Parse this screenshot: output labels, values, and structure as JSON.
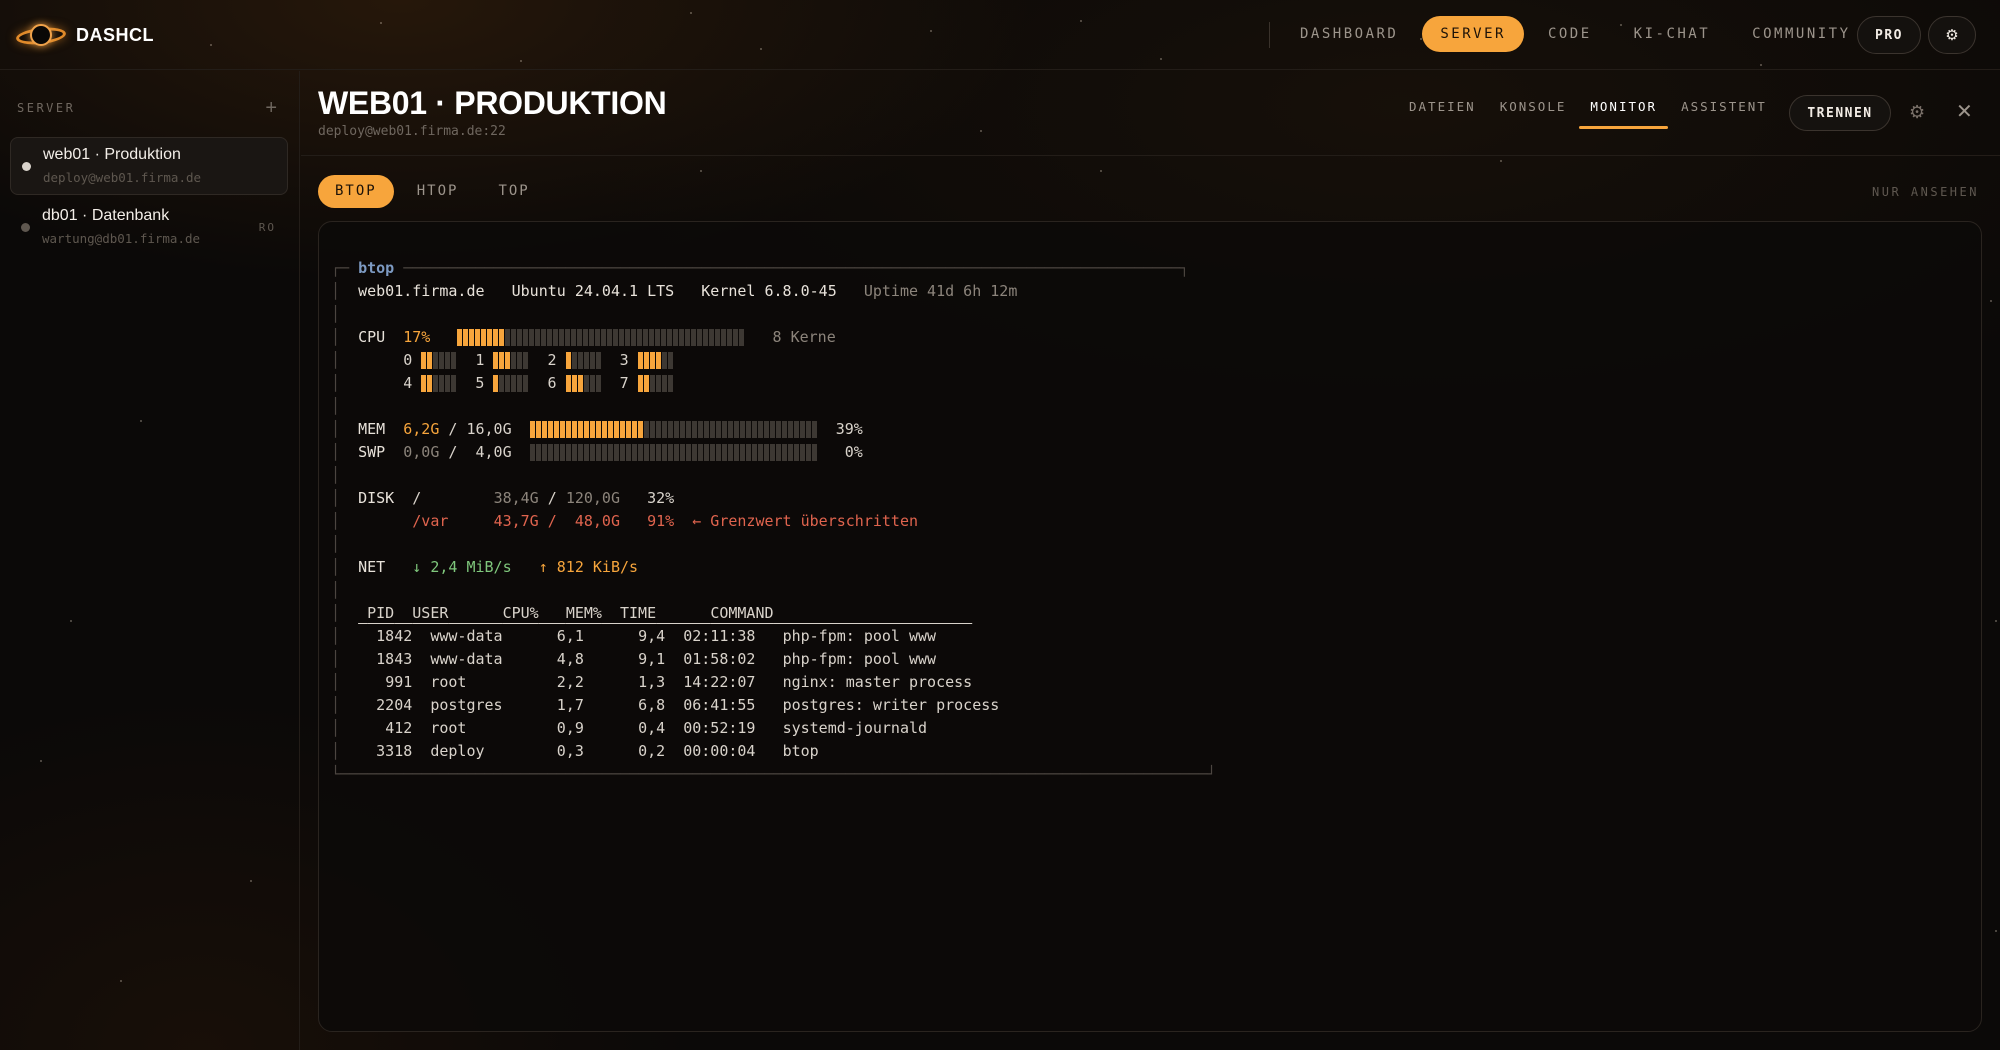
{
  "app": {
    "brand": "DASHCL"
  },
  "nav": {
    "items": [
      {
        "label": "DASHBOARD",
        "active": false
      },
      {
        "label": "SERVER",
        "active": true
      },
      {
        "label": "CODE",
        "active": false
      },
      {
        "label": "KI-CHAT",
        "active": false
      },
      {
        "label": "COMMUNITY",
        "active": false
      }
    ],
    "pro_label": "PRO",
    "settings_icon": "gear-icon"
  },
  "sidebar": {
    "title": "SERVER",
    "add_label": "+",
    "servers": [
      {
        "name": "web01 · Produktion",
        "address": "deploy@web01.firma.de",
        "badge": "",
        "active": true
      },
      {
        "name": "db01 · Datenbank",
        "address": "wartung@db01.firma.de",
        "badge": "RO",
        "active": false
      }
    ]
  },
  "header": {
    "title": "WEB01 · PRODUKTION",
    "subtitle": "deploy@web01.firma.de:22",
    "tabs": [
      {
        "label": "DATEIEN",
        "active": false
      },
      {
        "label": "KONSOLE",
        "active": false
      },
      {
        "label": "MONITOR",
        "active": true
      },
      {
        "label": "ASSISTENT",
        "active": false
      }
    ],
    "disconnect_label": "TRENNEN",
    "close_label": "✕",
    "gear_label": "⚙"
  },
  "tools": {
    "tabs": [
      {
        "label": "BTOP",
        "active": true
      },
      {
        "label": "HTOP",
        "active": false
      },
      {
        "label": "TOP",
        "active": false
      }
    ],
    "mode_label": "NUR ANSEHEN"
  },
  "monitor": {
    "box_title": "btop",
    "host": "web01.firma.de",
    "os": "Ubuntu 24.04.1 LTS",
    "kernel": "Kernel 6.8.0-45",
    "uptime": "Uptime 41d 6h 12m",
    "cpu": {
      "label": "CPU",
      "percent": "17%",
      "usage": 0.17,
      "cores_label": "8 Kerne",
      "cores": [
        {
          "id": "0",
          "usage": 0.33
        },
        {
          "id": "1",
          "usage": 0.5
        },
        {
          "id": "2",
          "usage": 0.17
        },
        {
          "id": "3",
          "usage": 0.67
        },
        {
          "id": "4",
          "usage": 0.33
        },
        {
          "id": "5",
          "usage": 0.17
        },
        {
          "id": "6",
          "usage": 0.5
        },
        {
          "id": "7",
          "usage": 0.33
        }
      ]
    },
    "mem": {
      "label": "MEM",
      "used": "6,2G",
      "total": "16,0G",
      "percent": "39%",
      "usage": 0.39
    },
    "swp": {
      "label": "SWP",
      "used": "0,0G",
      "total": "4,0G",
      "percent": "0%",
      "usage": 0
    },
    "disk": {
      "label": "DISK",
      "mounts": [
        {
          "mount": "/",
          "used": "38,4G",
          "total": "120,0G",
          "percent": "32%",
          "warning": ""
        },
        {
          "mount": "/var",
          "used": "43,7G",
          "total": "48,0G",
          "percent": "91%",
          "warning": "← Grenzwert überschritten"
        }
      ]
    },
    "net": {
      "label": "NET",
      "down": "↓ 2,4 MiB/s",
      "up": "↑ 812 KiB/s"
    },
    "process_columns": [
      "PID",
      "USER",
      "CPU%",
      "MEM%",
      "TIME",
      "COMMAND"
    ],
    "processes": [
      [
        "1842",
        "www-data",
        "6,1",
        "9,4",
        "02:11:38",
        "php-fpm: pool www"
      ],
      [
        "1843",
        "www-data",
        "4,8",
        "9,1",
        "01:58:02",
        "php-fpm: pool www"
      ],
      [
        "991",
        "root",
        "2,2",
        "1,3",
        "14:22:07",
        "nginx: master process"
      ],
      [
        "2204",
        "postgres",
        "1,7",
        "6,8",
        "06:41:55",
        "postgres: writer process"
      ],
      [
        "412",
        "root",
        "0,9",
        "0,4",
        "00:52:19",
        "systemd-journald"
      ],
      [
        "3318",
        "deploy",
        "0,3",
        "0,2",
        "00:00:04",
        "btop"
      ]
    ]
  },
  "colors": {
    "accent": "#f7a53c",
    "danger": "#e0644e",
    "success": "#7fc77c",
    "title_blue": "#7d9ac2"
  }
}
